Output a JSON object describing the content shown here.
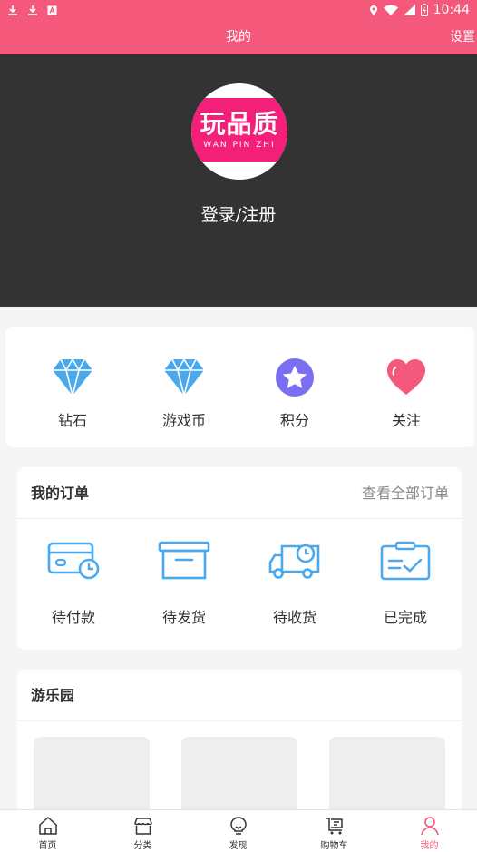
{
  "status_bar": {
    "time": "10:44",
    "left_icons": [
      "download-icon",
      "download-icon",
      "a-letter-icon"
    ],
    "right_icons": [
      "location-icon",
      "wifi-icon",
      "signal-icon",
      "battery-icon"
    ]
  },
  "app_bar": {
    "title": "我的",
    "settings_label": "设置",
    "color": "#f4597c"
  },
  "profile": {
    "logo_text": "玩品质",
    "logo_subtext": "WAN PIN ZHI",
    "login_label": "登录/注册",
    "background": "#333333"
  },
  "quick_actions": [
    {
      "label": "钻石",
      "icon": "diamond-icon"
    },
    {
      "label": "游戏币",
      "icon": "diamond-icon"
    },
    {
      "label": "积分",
      "icon": "star-badge-icon"
    },
    {
      "label": "关注",
      "icon": "heart-icon"
    }
  ],
  "orders": {
    "title": "我的订单",
    "view_all_label": "查看全部订单",
    "items": [
      {
        "label": "待付款",
        "icon": "card-clock-icon"
      },
      {
        "label": "待发货",
        "icon": "box-icon"
      },
      {
        "label": "待收货",
        "icon": "truck-clock-icon"
      },
      {
        "label": "已完成",
        "icon": "clipboard-check-icon"
      }
    ]
  },
  "park": {
    "title": "游乐园"
  },
  "tab_bar": {
    "active": "我的",
    "accent": "#f4597c",
    "items": [
      {
        "label": "首页",
        "icon": "home-icon"
      },
      {
        "label": "分类",
        "icon": "store-icon"
      },
      {
        "label": "发现",
        "icon": "lightbulb-icon"
      },
      {
        "label": "购物车",
        "icon": "cart-icon"
      },
      {
        "label": "我的",
        "icon": "person-icon"
      }
    ]
  }
}
